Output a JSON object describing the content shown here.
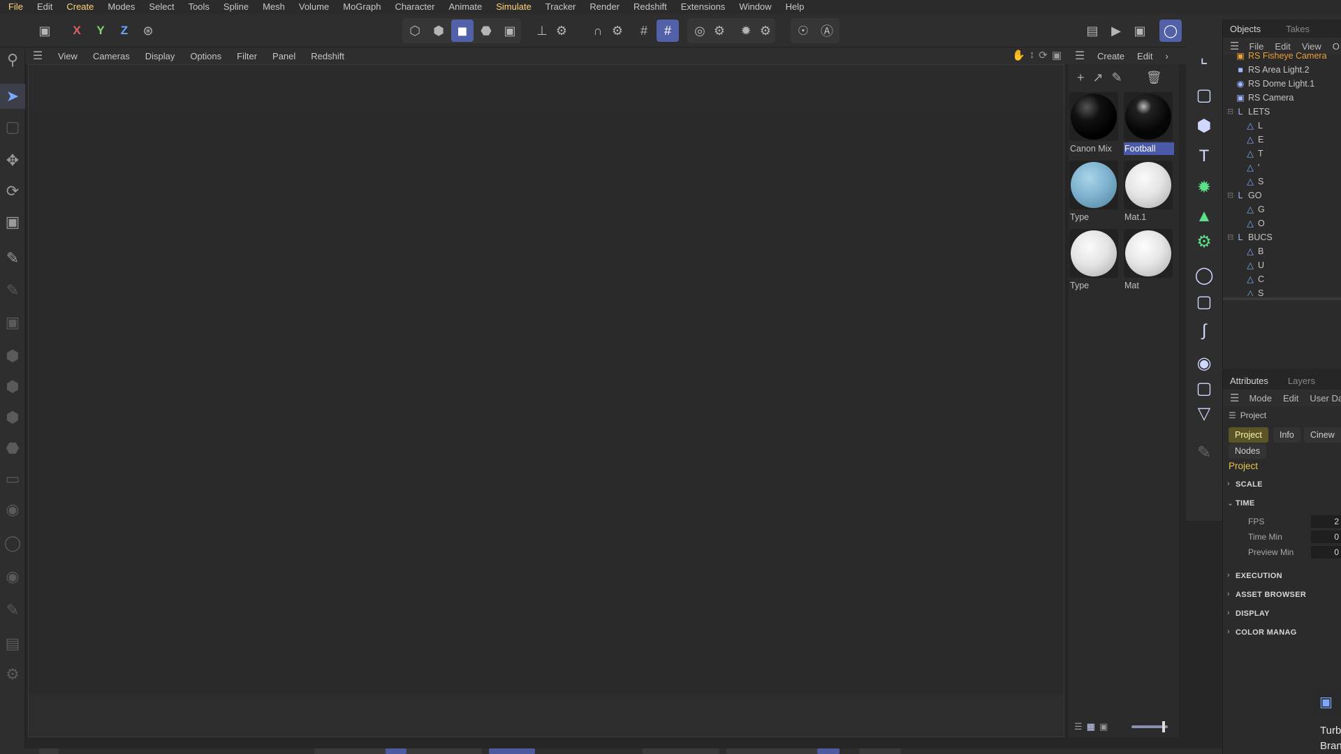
{
  "menu": [
    "File",
    "Edit",
    "Create",
    "Modes",
    "Select",
    "Tools",
    "Spline",
    "Mesh",
    "Volume",
    "MoGraph",
    "Character",
    "Animate",
    "Simulate",
    "Tracker",
    "Render",
    "Redshift",
    "Extensions",
    "Window",
    "Help"
  ],
  "axes": {
    "x": "X",
    "y": "Y",
    "z": "Z"
  },
  "viewport_menu": [
    "View",
    "Cameras",
    "Display",
    "Options",
    "Filter",
    "Panel",
    "Redshift"
  ],
  "material_menu": [
    "Create",
    "Edit"
  ],
  "materials": [
    {
      "name": "Canon Mix",
      "color": "#0a0a0a",
      "selected": false
    },
    {
      "name": "Football",
      "color": "#0a0a0a",
      "selected": true
    },
    {
      "name": "Type",
      "color": "#7fb3cf",
      "selected": false
    },
    {
      "name": "Mat.1",
      "color": "#e4e4e4",
      "selected": false
    },
    {
      "name": "Type",
      "color": "#e4e4e4",
      "selected": false
    },
    {
      "name": "Mat",
      "color": "#e6e6e6",
      "selected": false
    }
  ],
  "objects_tabs": [
    "Objects",
    "Takes"
  ],
  "objects_menu": [
    "File",
    "Edit",
    "View",
    "O"
  ],
  "objects": [
    {
      "label": "RS Fisheye Camera",
      "icon": "camera-icon",
      "highlight": true
    },
    {
      "label": "RS Area Light.2",
      "icon": "light-icon",
      "highlight": false
    },
    {
      "label": "RS Dome Light.1",
      "icon": "globe-icon",
      "highlight": false
    },
    {
      "label": "RS Camera",
      "icon": "camera-icon",
      "highlight": false
    },
    {
      "label": "LETS",
      "icon": "group-icon",
      "highlight": false
    },
    {
      "label": "L",
      "icon": "figure-icon",
      "highlight": false
    },
    {
      "label": "E",
      "icon": "figure-icon",
      "highlight": false
    },
    {
      "label": "T",
      "icon": "figure-icon",
      "highlight": false
    },
    {
      "label": "'",
      "icon": "figure-icon",
      "highlight": false
    },
    {
      "label": "S",
      "icon": "figure-icon",
      "highlight": false
    },
    {
      "label": "GO",
      "icon": "group-icon",
      "highlight": false
    },
    {
      "label": "G",
      "icon": "figure-icon",
      "highlight": false
    },
    {
      "label": "O",
      "icon": "figure-icon",
      "highlight": false
    },
    {
      "label": "BUCS",
      "icon": "group-icon",
      "highlight": false
    },
    {
      "label": "B",
      "icon": "figure-icon",
      "highlight": false
    },
    {
      "label": "U",
      "icon": "figure-icon",
      "highlight": false
    },
    {
      "label": "C",
      "icon": "figure-icon",
      "highlight": false
    },
    {
      "label": "S",
      "icon": "figure-icon",
      "highlight": false
    }
  ],
  "attributes": {
    "tabs": [
      "Attributes",
      "Layers"
    ],
    "menu": [
      "Mode",
      "Edit",
      "User Da"
    ],
    "breadcrumb": "Project",
    "buttons": [
      "Project",
      "Info",
      "Cinew"
    ],
    "nodes_button": "Nodes",
    "title": "Project",
    "sections": {
      "scale": "SCALE",
      "time": "TIME",
      "execution": "EXECUTION",
      "asset_browser": "ASSET BROWSER",
      "display": "DISPLAY",
      "color_manage": "COLOR MANAG"
    },
    "fields": [
      {
        "label": "FPS",
        "value": "2"
      },
      {
        "label": "Time Min",
        "value": "0"
      },
      {
        "label": "Preview Min",
        "value": "0"
      }
    ]
  },
  "corner_text": [
    "Turb",
    "Bran"
  ]
}
